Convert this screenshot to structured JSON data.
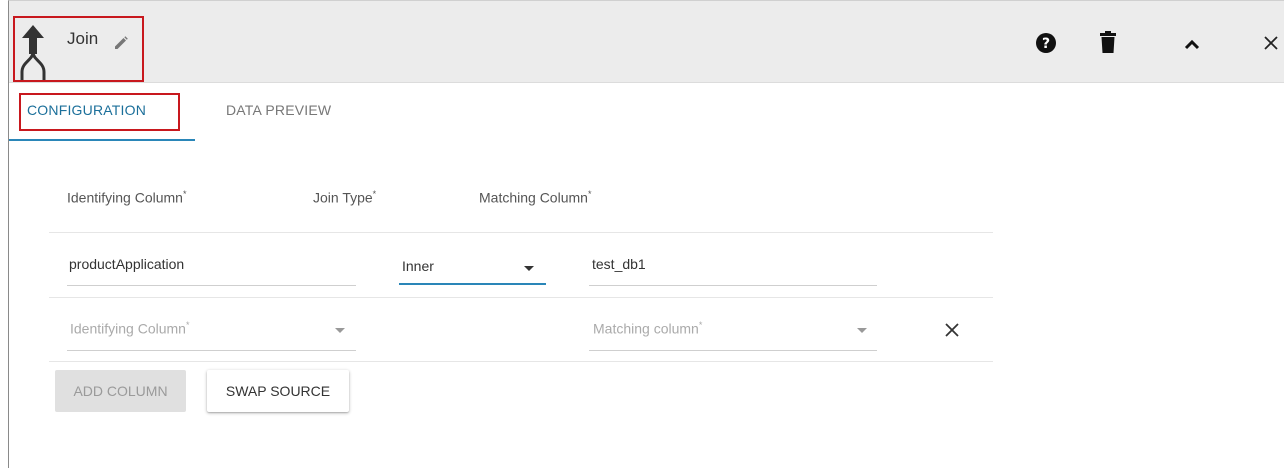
{
  "header": {
    "title": "Join",
    "icons": [
      "join-icon",
      "edit-pencil-icon",
      "help-icon",
      "delete-icon",
      "collapse-icon",
      "close-icon"
    ]
  },
  "tabs": [
    {
      "label": "CONFIGURATION",
      "active": true
    },
    {
      "label": "DATA PREVIEW",
      "active": false
    }
  ],
  "columns": {
    "identifying": "Identifying Column",
    "join_type": "Join Type",
    "matching": "Matching Column",
    "required_mark": "*"
  },
  "rows": [
    {
      "identifying": "productApplication",
      "join_type": "Inner",
      "matching": "test_db1"
    }
  ],
  "new_row": {
    "identifying_placeholder": "Identifying Column",
    "matching_placeholder": "Matching column",
    "required_mark": "*"
  },
  "buttons": {
    "add_column": "ADD COLUMN",
    "swap_source": "SWAP SOURCE"
  },
  "colors": {
    "accent": "#2a86b8",
    "highlight": "#c8181e",
    "header_bg": "#ececec"
  }
}
